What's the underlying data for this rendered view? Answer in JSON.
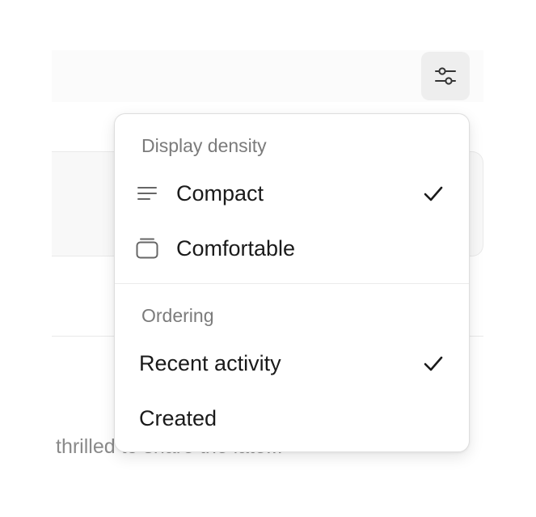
{
  "background": {
    "snippet": "thrilled to share the late..."
  },
  "toolbar": {
    "filter_icon": "sliders-icon"
  },
  "menu": {
    "density": {
      "label": "Display density",
      "items": [
        {
          "label": "Compact",
          "icon": "lines-icon",
          "checked": true
        },
        {
          "label": "Comfortable",
          "icon": "card-stack-icon",
          "checked": false
        }
      ]
    },
    "ordering": {
      "label": "Ordering",
      "items": [
        {
          "label": "Recent activity",
          "checked": true
        },
        {
          "label": "Created",
          "checked": false
        }
      ]
    }
  },
  "colors": {
    "text": "#1a1a1a",
    "muted": "#7b7b7b",
    "button_bg": "#eeeeee",
    "border": "#dedede"
  }
}
